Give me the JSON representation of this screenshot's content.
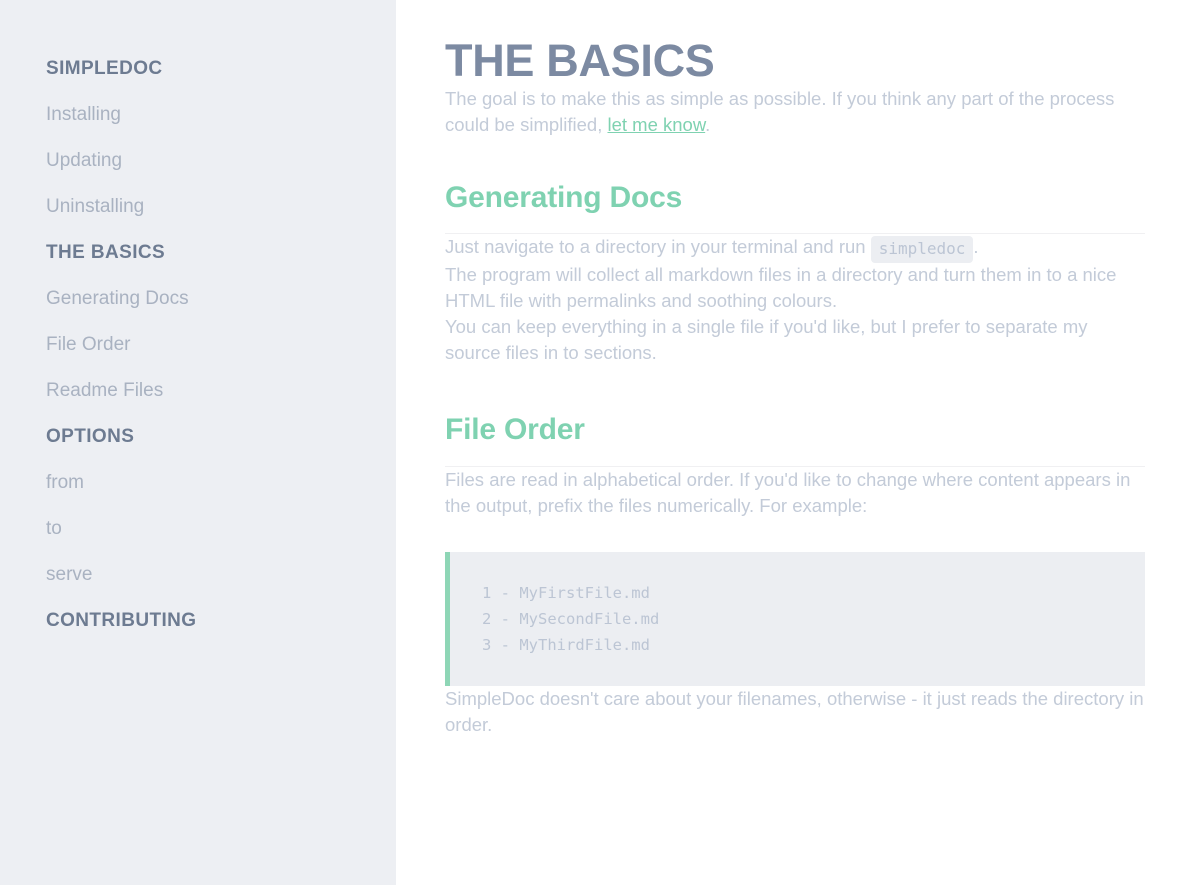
{
  "sidebar": {
    "entries": [
      {
        "label": "SIMPLEDOC",
        "type": "header"
      },
      {
        "label": "Installing",
        "type": "item"
      },
      {
        "label": "Updating",
        "type": "item"
      },
      {
        "label": "Uninstalling",
        "type": "item"
      },
      {
        "label": "THE BASICS",
        "type": "header"
      },
      {
        "label": "Generating Docs",
        "type": "item"
      },
      {
        "label": "File Order",
        "type": "item"
      },
      {
        "label": "Readme Files",
        "type": "item"
      },
      {
        "label": "OPTIONS",
        "type": "header"
      },
      {
        "label": "from",
        "type": "item"
      },
      {
        "label": "to",
        "type": "item"
      },
      {
        "label": "serve",
        "type": "item"
      },
      {
        "label": "CONTRIBUTING",
        "type": "header"
      }
    ]
  },
  "main": {
    "title": "THE BASICS",
    "intro": {
      "before_link": "The goal is to make this as simple as possible. If you think any part of the process could be simplified, ",
      "link_text": "let me know",
      "after_link": "."
    },
    "sections": [
      {
        "heading": "Generating Docs",
        "para_before_code": "Just navigate to a directory in your terminal and run",
        "inline_code": "simpledoc",
        "para_after_code": ".",
        "para_2": "The program will collect all markdown files in a directory and turn them in to a nice HTML file with permalinks and soothing colours.",
        "para_3": "You can keep everything in a single file if you'd like, but I prefer to separate my source files in to sections."
      },
      {
        "heading": "File Order",
        "para_1": "Files are read in alphabetical order. If you'd like to change where content appears in the output, prefix the files numerically. For example:",
        "code_lines": [
          "1 - MyFirstFile.md",
          "2 - MySecondFile.md",
          "3 - MyThirdFile.md"
        ],
        "para_2": "SimpleDoc doesn't care about your filenames, otherwise - it just reads the directory in order."
      }
    ]
  },
  "colors": {
    "accent_green": "#7fd2b1",
    "title_slate": "#7c8aa2",
    "body_gray": "#c3cbd8",
    "sidebar_bg": "#edeff3",
    "code_bg": "#eceef2"
  }
}
